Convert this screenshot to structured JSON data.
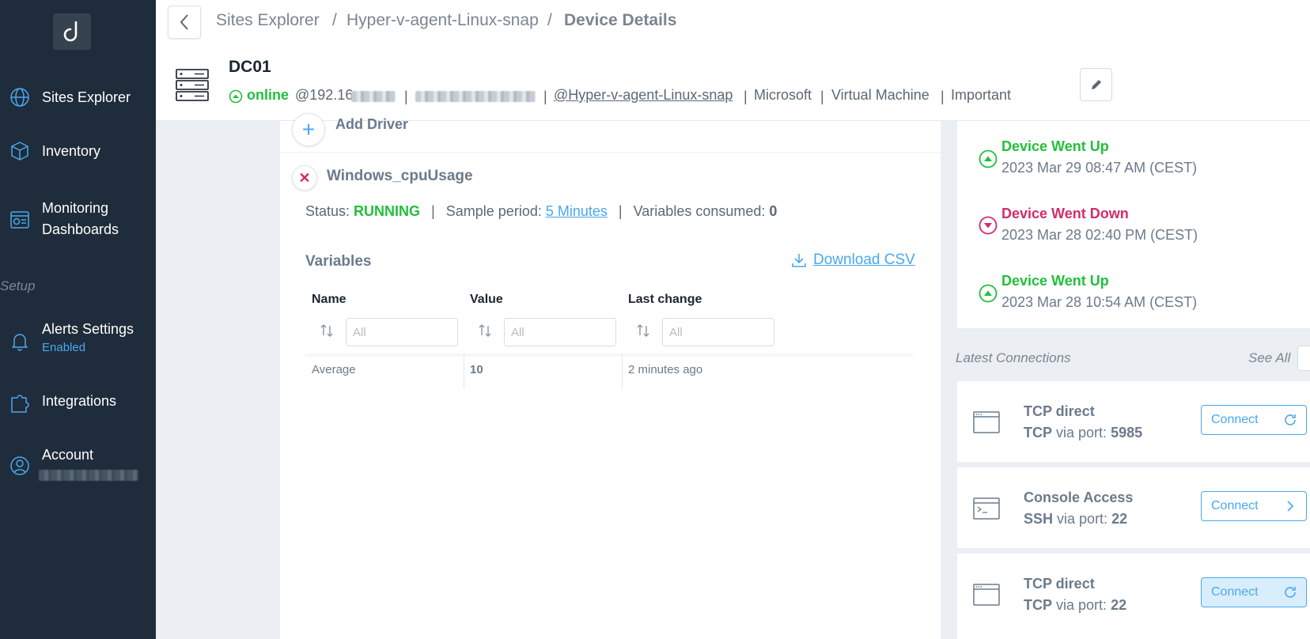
{
  "sidebar": {
    "items": [
      {
        "label": "Sites Explorer"
      },
      {
        "label": "Inventory"
      },
      {
        "label_line1": "Monitoring",
        "label_line2": "Dashboards"
      },
      {
        "label": "Alerts Settings",
        "sublabel": "Enabled"
      },
      {
        "label": "Integrations"
      },
      {
        "label": "Account"
      }
    ],
    "section_setup": "Setup"
  },
  "breadcrumb": {
    "root": "Sites Explorer",
    "sep": "/",
    "site": "Hyper-v-agent-Linux-snap",
    "current": "Device Details"
  },
  "device": {
    "name": "DC01",
    "status": "online",
    "ip_prefix": "@192.16",
    "site_link": "@Hyper-v-agent-Linux-snap",
    "vendor": "Microsoft",
    "type": "Virtual Machine",
    "importance": "Important",
    "sep": "|"
  },
  "driver": {
    "add_label": "Add Driver",
    "name": "Windows_cpuUsage",
    "status_label": "Status:",
    "status_value": "RUNNING",
    "sample_label": "Sample period:",
    "sample_value": "5 Minutes",
    "consumed_label": "Variables consumed:",
    "consumed_value": "0",
    "sep": "|"
  },
  "variables": {
    "title": "Variables",
    "download_label": "Download CSV",
    "columns": [
      "Name",
      "Value",
      "Last change"
    ],
    "filter_placeholder": "All",
    "rows": [
      {
        "name": "Average",
        "value": "10",
        "last_change": "2 minutes ago"
      }
    ]
  },
  "events": [
    {
      "title": "Device Went Up",
      "time": "2023 Mar 29 08:47 AM (CEST)",
      "kind": "up"
    },
    {
      "title": "Device Went Down",
      "time": "2023 Mar 28 02:40 PM (CEST)",
      "kind": "down"
    },
    {
      "title": "Device Went Up",
      "time": "2023 Mar 28 10:54 AM (CEST)",
      "kind": "up"
    }
  ],
  "connections": {
    "title": "Latest Connections",
    "see_all": "See All",
    "via_label": "via port:",
    "items": [
      {
        "name": "TCP direct",
        "protocol": "TCP",
        "port": "5985",
        "button": "Connect",
        "icon": "browser-window-icon",
        "action_icon": "refresh-icon"
      },
      {
        "name": "Console Access",
        "protocol": "SSH",
        "port": "22",
        "button": "Connect",
        "icon": "terminal-icon",
        "action_icon": "chevron-right-icon"
      },
      {
        "name": "TCP direct",
        "protocol": "TCP",
        "port": "22",
        "button": "Connect",
        "icon": "browser-window-icon",
        "action_icon": "refresh-icon"
      }
    ]
  },
  "colors": {
    "sidebar_bg": "#1f2c3b",
    "accent": "#4aa8ee",
    "online_green": "#22c03b",
    "down_pink": "#d42b6a"
  }
}
